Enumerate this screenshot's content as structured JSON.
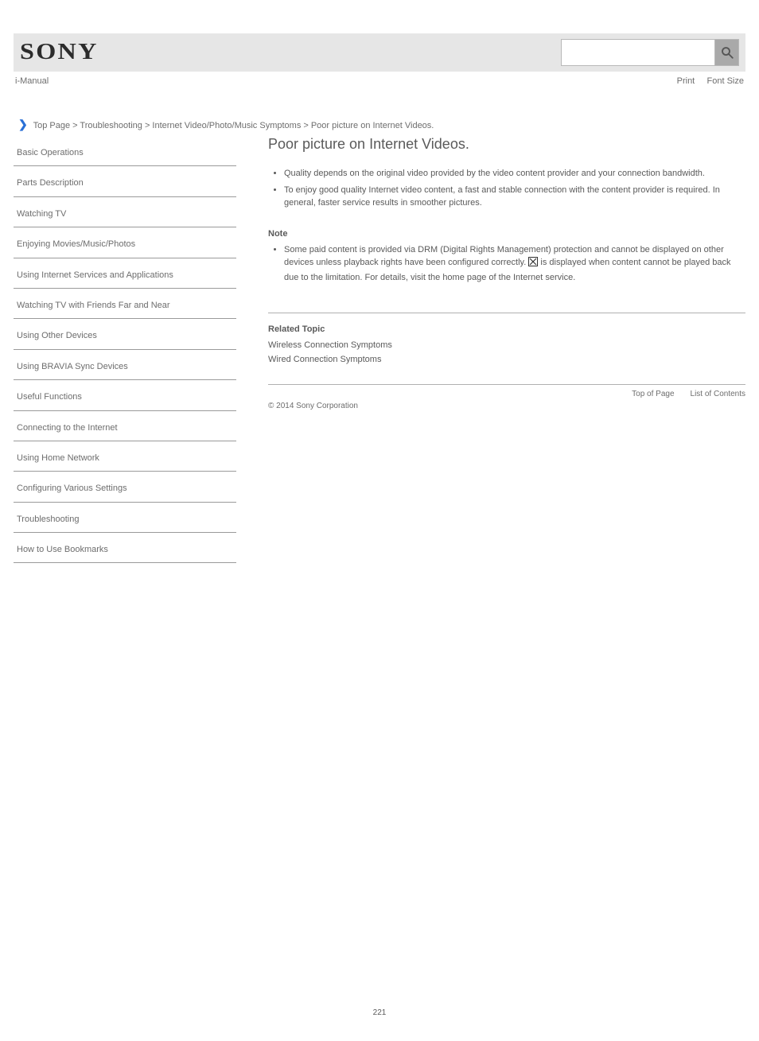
{
  "brand": "SONY",
  "manual_title": "i-Manual",
  "top_right": {
    "print": "Print",
    "font": "Font Size"
  },
  "search": {
    "placeholder": ""
  },
  "breadcrumb": "Top Page > Troubleshooting > Internet Video/Photo/Music Symptoms > Poor picture on Internet Videos.",
  "sidebar": {
    "items": [
      "Basic Operations",
      "Parts Description",
      "Watching TV",
      "Enjoying Movies/Music/Photos",
      "Using Internet Services and Applications",
      "Watching TV with Friends Far and Near",
      "Using Other Devices",
      "Using BRAVIA Sync Devices",
      "Useful Functions",
      "Connecting to the Internet",
      "Using Home Network",
      "Configuring Various Settings",
      "Troubleshooting",
      "How to Use Bookmarks"
    ]
  },
  "content": {
    "title": "Poor picture on Internet Videos.",
    "bullets": [
      "Quality depends on the original video provided by the video content provider and your connection bandwidth.",
      "To enjoy good quality Internet video content, a fast and stable connection with the content provider is required. In general, faster service results in smoother pictures."
    ],
    "note_label": "Note",
    "notes": [
      "Some paid content is provided via DRM (Digital Rights Management) protection and cannot be displayed on other devices unless playback rights have been configured correctly. **** is displayed when content cannot be played back due to the limitation. For details, visit the home page of the Internet service."
    ],
    "related_label": "Related Topic",
    "related_links": [
      "Wireless Connection Symptoms",
      "Wired Connection Symptoms"
    ],
    "page_number": "221"
  },
  "footer": {
    "top": "Top of Page",
    "list": "List of Contents",
    "copyright": "© 2014 Sony Corporation"
  }
}
